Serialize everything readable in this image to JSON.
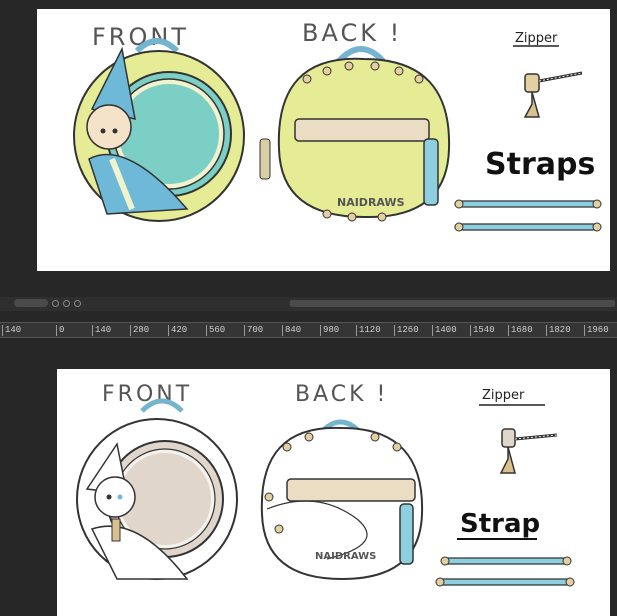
{
  "top_panel": {
    "front_label": "FRONT",
    "back_label": "BACK !",
    "zipper_label": "Zipper",
    "straps_label": "Straps",
    "watermark": "NAIDRAWS"
  },
  "bottom_panel": {
    "front_label": "FRONT",
    "back_label": "BACK !",
    "zipper_label": "Zipper",
    "straps_label": "Strap",
    "watermark": "NAIDRAWS"
  },
  "ruler": {
    "ticks": [
      "140",
      "0",
      "140",
      "280",
      "420",
      "560",
      "700",
      "840",
      "980",
      "1120",
      "1260",
      "1400",
      "1540",
      "1680",
      "1820",
      "1960"
    ]
  },
  "colors": {
    "workspace": "#272727",
    "plush_yellow": "#e6eb95",
    "teal_window": "#7bcfc4",
    "strap_blue": "#8ecfdf",
    "panel_beige": "#eaddc4",
    "inner_window": "#e0d6cc"
  },
  "icons": [
    "collapse-pill-icon",
    "rotate-icon",
    "history-icon",
    "circle-icon"
  ]
}
